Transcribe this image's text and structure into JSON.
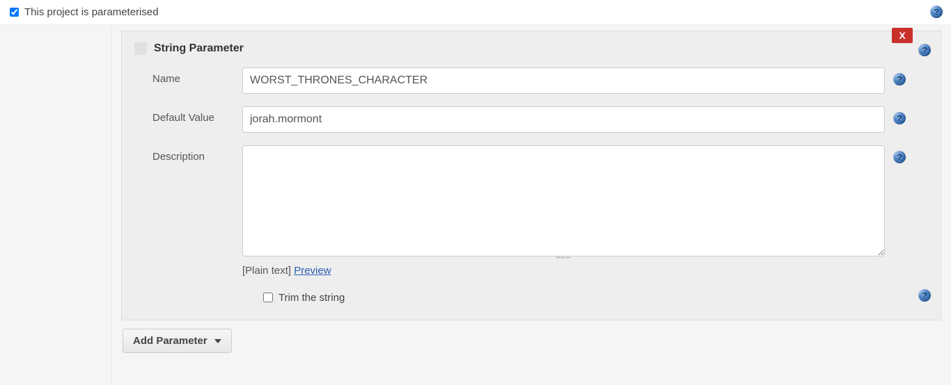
{
  "header": {
    "checkbox_label": "This project is parameterised",
    "checked": true
  },
  "parameter": {
    "title": "String Parameter",
    "delete_label": "X",
    "fields": {
      "name": {
        "label": "Name",
        "value": "WORST_THRONES_CHARACTER"
      },
      "default_value": {
        "label": "Default Value",
        "value": "jorah.mormont"
      },
      "description": {
        "label": "Description",
        "value": "",
        "format_note_prefix": "[Plain text] ",
        "preview_link": "Preview"
      },
      "trim": {
        "label": "Trim the string",
        "checked": false
      }
    }
  },
  "add_parameter_label": "Add Parameter"
}
